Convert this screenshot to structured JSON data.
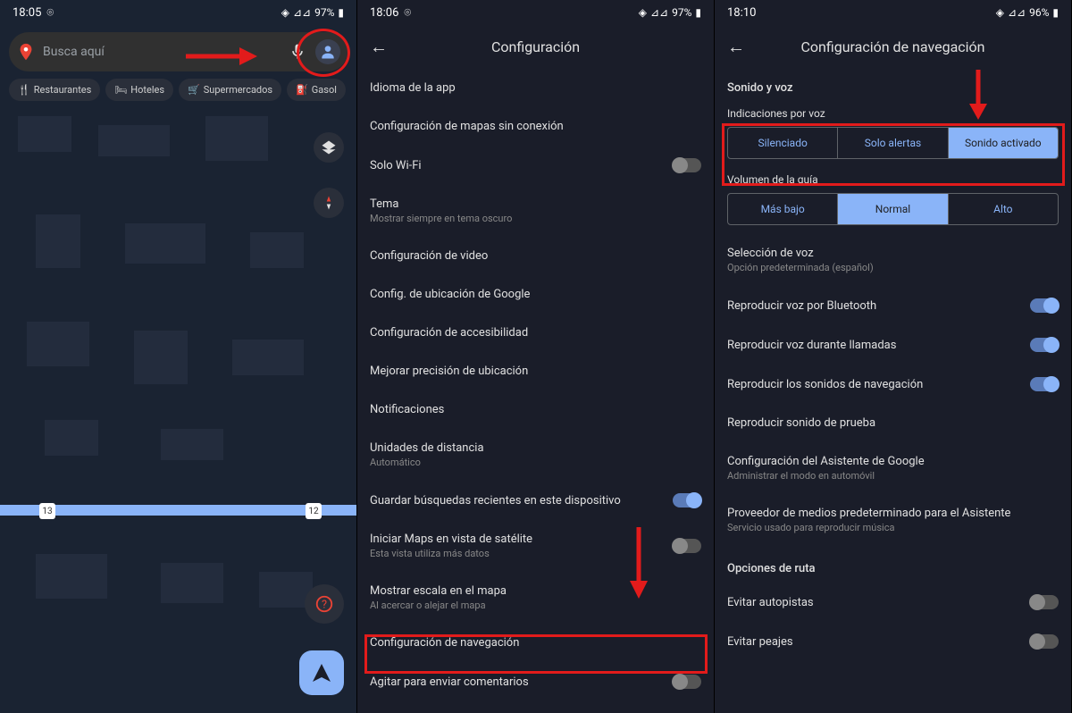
{
  "panel1": {
    "status": {
      "time": "18:05",
      "battery": "97%"
    },
    "search_placeholder": "Busca aquí",
    "chips": [
      "Restaurantes",
      "Hoteles",
      "Supermercados",
      "Gasol"
    ],
    "route_markers": [
      "13",
      "12"
    ]
  },
  "panel2": {
    "status": {
      "time": "18:06",
      "battery": "97%"
    },
    "title": "Configuración",
    "items": [
      {
        "label": "Idioma de la app"
      },
      {
        "label": "Configuración de mapas sin conexión"
      },
      {
        "label": "Solo Wi-Fi",
        "toggle": false
      },
      {
        "label": "Tema",
        "sub": "Mostrar siempre en tema oscuro"
      },
      {
        "label": "Configuración de video"
      },
      {
        "label": "Config. de ubicación de Google"
      },
      {
        "label": "Configuración de accesibilidad"
      },
      {
        "label": "Mejorar precisión de ubicación"
      },
      {
        "label": "Notificaciones"
      },
      {
        "label": "Unidades de distancia",
        "sub": "Automático"
      },
      {
        "label": "Guardar búsquedas recientes en este dispositivo",
        "toggle": true
      },
      {
        "label": "Iniciar Maps en vista de satélite",
        "sub": "Esta vista utiliza más datos",
        "toggle": false
      },
      {
        "label": "Mostrar escala en el mapa",
        "sub": "Al acercar o alejar el mapa"
      },
      {
        "label": "Configuración de navegación"
      },
      {
        "label": "Agitar para enviar comentarios",
        "toggle": false
      }
    ]
  },
  "panel3": {
    "status": {
      "time": "18:10",
      "battery": "96%"
    },
    "title": "Configuración de navegación",
    "sound_section": "Sonido y voz",
    "voice_label": "Indicaciones por voz",
    "voice_options": [
      "Silenciado",
      "Solo alertas",
      "Sonido activado"
    ],
    "voice_active": 2,
    "volume_label": "Volumen de la guía",
    "volume_options": [
      "Más bajo",
      "Normal",
      "Alto"
    ],
    "volume_active": 1,
    "items": [
      {
        "label": "Selección de voz",
        "sub": "Opción predeterminada (español)"
      },
      {
        "label": "Reproducir voz por Bluetooth",
        "toggle": true
      },
      {
        "label": "Reproducir voz durante llamadas",
        "toggle": true
      },
      {
        "label": "Reproducir los sonidos de navegación",
        "toggle": true
      },
      {
        "label": "Reproducir sonido de prueba"
      },
      {
        "label": "Configuración del Asistente de Google",
        "sub": "Administrar el modo en automóvil"
      },
      {
        "label": "Proveedor de medios predeterminado para el Asistente",
        "sub": "Servicio usado para reproducir música"
      }
    ],
    "route_section": "Opciones de ruta",
    "route_items": [
      {
        "label": "Evitar autopistas",
        "toggle": false
      },
      {
        "label": "Evitar peajes",
        "toggle": false
      }
    ]
  }
}
